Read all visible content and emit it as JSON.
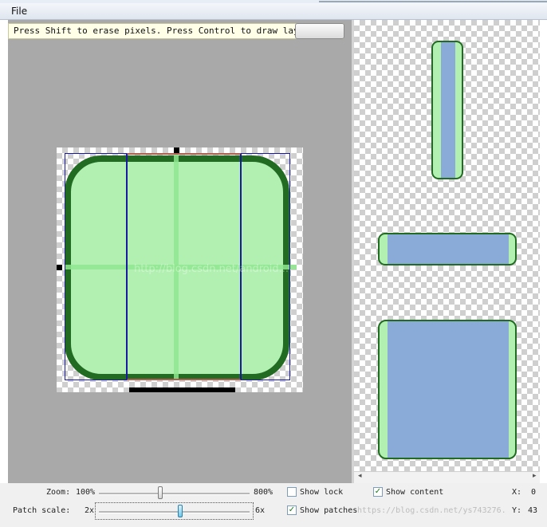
{
  "menu": {
    "file_label": "File"
  },
  "editor": {
    "hint_text": "Press Shift to erase pixels. Press Control to draw layout boundsues",
    "watermark": "http://blog.csdn.net/android..."
  },
  "controls": {
    "zoom_label": "Zoom:",
    "zoom_min": "100%",
    "zoom_max": "800%",
    "zoom_level": 0.41,
    "patch_scale_label": "Patch scale:",
    "patch_min": "2x",
    "patch_max": "6x",
    "patch_level": 0.54,
    "show_lock_label": "Show lock",
    "show_lock_checked": false,
    "show_content_label": "Show content",
    "show_content_checked": true,
    "show_patches_label": "Show patches",
    "show_patches_checked": true,
    "x_label": "X:",
    "x_value": "0",
    "y_label": "Y:",
    "y_value": "43",
    "status_watermark": "https://blog.csdn.net/ys743276..."
  },
  "colors": {
    "fill": "#b2f0b2",
    "border": "#226b22",
    "content": "#8aaad8",
    "patch_guide": "#8fe68f",
    "marker": "#000000"
  },
  "icons": {
    "scroll_left": "◂",
    "scroll_right": "▸",
    "check_mark": "✓"
  }
}
